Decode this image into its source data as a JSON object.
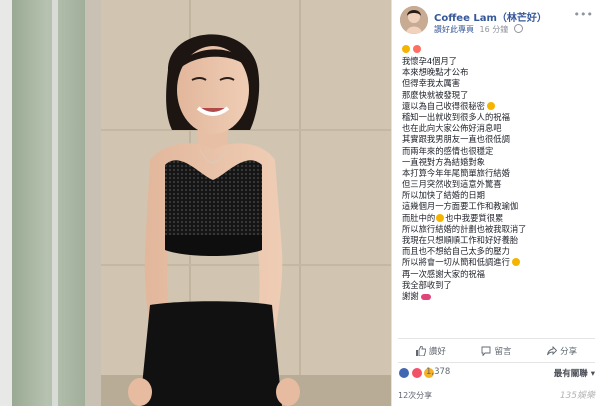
{
  "post": {
    "author": "Coffee Lam（林芒好）",
    "page_status": "讚好此專頁",
    "time": "16 分鐘",
    "more_icon": "more-icon",
    "lines": [
      "我懷孕4個月了",
      "本來想晚點才公布",
      "但得幸我太厲害",
      "那麼快就被發現了",
      "還以為自己收得很秘密",
      "稽知一出就收到很多人的祝福",
      "也在此向大家公佈好消息吧",
      "其實跟我男朋友一直也很低調",
      "而兩年來的感情也很穩定",
      "一直視對方為結婚對象",
      "本打算今年年尾簡單旅行結婚",
      "但三月突然收到這意外驚喜",
      "所以加快了結婚的日期",
      "這幾個月一方面要工作和教瑜伽",
      "而肚中的",
      "所以旅行結婚的計劃也被我取消了",
      "我現在只想順順工作和好好養胎",
      "而且也不想給自己太多的壓力",
      "所以將會一切从簡和低調進行",
      "再一次感謝大家的祝福",
      "我全部收到了",
      "謝謝"
    ],
    "line_14_suffix": "也中我要質很累",
    "emoji_colors": [
      "#f5b400",
      "#ff6f61",
      "#f5b400"
    ]
  },
  "actions": {
    "like": "讚好",
    "comment": "留言",
    "share": "分享"
  },
  "reactions": {
    "count": "1,378",
    "sort_label": "最有關聯",
    "colors": [
      "#4267b2",
      "#f25268",
      "#f7b125"
    ]
  },
  "footer": {
    "shares": "12次分享",
    "watermark": "135娛樂"
  },
  "colors": {
    "link": "#365899",
    "text": "#1d2129",
    "muted": "#90949c"
  }
}
